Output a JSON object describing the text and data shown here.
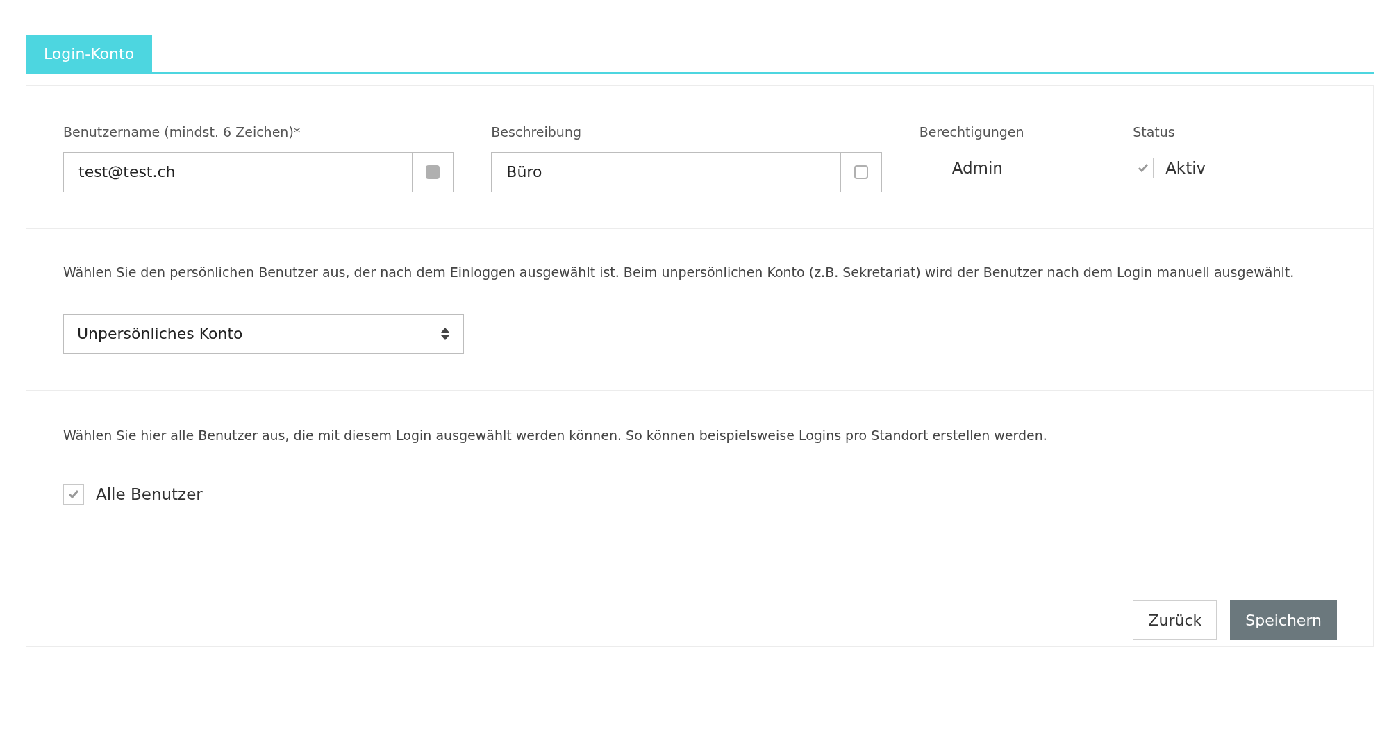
{
  "tabs": [
    {
      "label": "Login-Konto",
      "selected": true
    }
  ],
  "fields": [
    {
      "label": "Benutzername (mindst. 6 Zeichen)*",
      "value": "test@test.ch",
      "addon_checked": true
    },
    {
      "label": "Beschreibung",
      "value": "Büro",
      "addon_checked": false
    }
  ],
  "checks": [
    {
      "heading": "Berechtigungen",
      "label": "Admin",
      "checked": false
    },
    {
      "heading": "Status",
      "label": "Aktiv",
      "checked": true
    }
  ],
  "personal_user": {
    "description": "Wählen Sie den persönlichen Benutzer aus, der nach dem Einloggen ausgewählt ist. Beim unpersönlichen Konto (z.B. Sekretariat) wird der Benutzer nach dem Login manuell ausgewählt.",
    "select_value": "Unpersönliches Konto"
  },
  "users": {
    "description": "Wählen Sie hier alle Benutzer aus, die mit diesem Login ausgewählt werden können. So können beispielsweise Logins pro Standort erstellen werden.",
    "all_users": {
      "label": "Alle Benutzer",
      "checked": true
    }
  },
  "buttons": [
    {
      "label": "Zurück",
      "kind": "secondary"
    },
    {
      "label": "Speichern",
      "kind": "primary"
    }
  ]
}
